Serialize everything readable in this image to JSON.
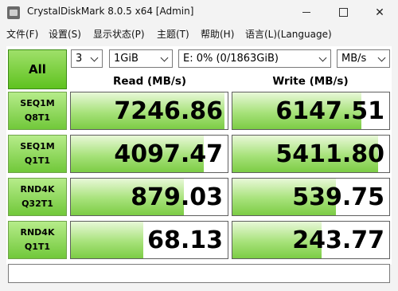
{
  "window": {
    "title": "CrystalDiskMark 8.0.5 x64 [Admin]",
    "minimize_glyph": "",
    "maximize_glyph": "",
    "close_glyph": "✕"
  },
  "menu": [
    "文件(F)",
    "设置(S)",
    "显示状态(P)",
    "主题(T)",
    "帮助(H)",
    "语言(L)(Language)"
  ],
  "controls": {
    "all_label": "All",
    "count": "3",
    "size": "1GiB",
    "drive": "E: 0% (0/1863GiB)",
    "unit": "MB/s"
  },
  "headers": {
    "read": "Read (MB/s)",
    "write": "Write (MB/s)"
  },
  "rows": [
    {
      "line1": "SEQ1M",
      "line2": "Q8T1",
      "read": "7246.86",
      "write": "6147.51",
      "read_fill": 0.98,
      "write_fill": 0.82
    },
    {
      "line1": "SEQ1M",
      "line2": "Q1T1",
      "read": "4097.47",
      "write": "5411.80",
      "read_fill": 0.85,
      "write_fill": 0.93
    },
    {
      "line1": "RND4K",
      "line2": "Q32T1",
      "read": "879.03",
      "write": "539.75",
      "read_fill": 0.72,
      "write_fill": 0.66
    },
    {
      "line1": "RND4K",
      "line2": "Q1T1",
      "read": "68.13",
      "write": "243.77",
      "read_fill": 0.46,
      "write_fill": 0.57
    }
  ],
  "comment": ""
}
